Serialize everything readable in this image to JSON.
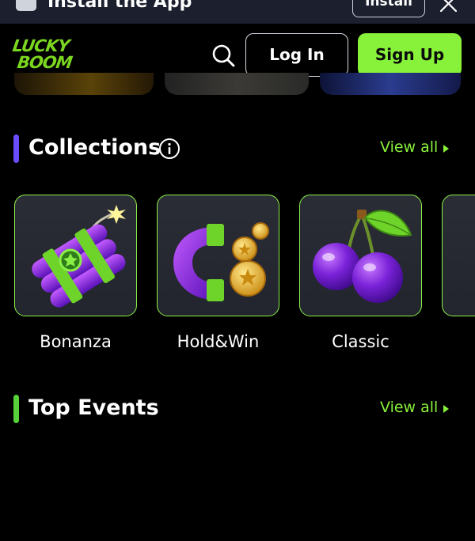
{
  "install_bar": {
    "title": "Install the App",
    "install_label": "Install"
  },
  "header": {
    "logo_line1": "LUCKY",
    "logo_line2": "BOOM",
    "login_label": "Log In",
    "signup_label": "Sign Up"
  },
  "collections": {
    "title": "Collections",
    "view_all": "View all",
    "items": [
      {
        "label": "Bonanza",
        "icon": "dynamite-icon"
      },
      {
        "label": "Hold&Win",
        "icon": "magnet-coins-icon"
      },
      {
        "label": "Classic",
        "icon": "cherries-icon"
      }
    ]
  },
  "top_events": {
    "title": "Top Events",
    "view_all": "View all"
  },
  "colors": {
    "accent_green": "#88f23a",
    "collections_accent": "#6a4cff",
    "top_events_accent": "#58d23a",
    "background": "#000000"
  }
}
